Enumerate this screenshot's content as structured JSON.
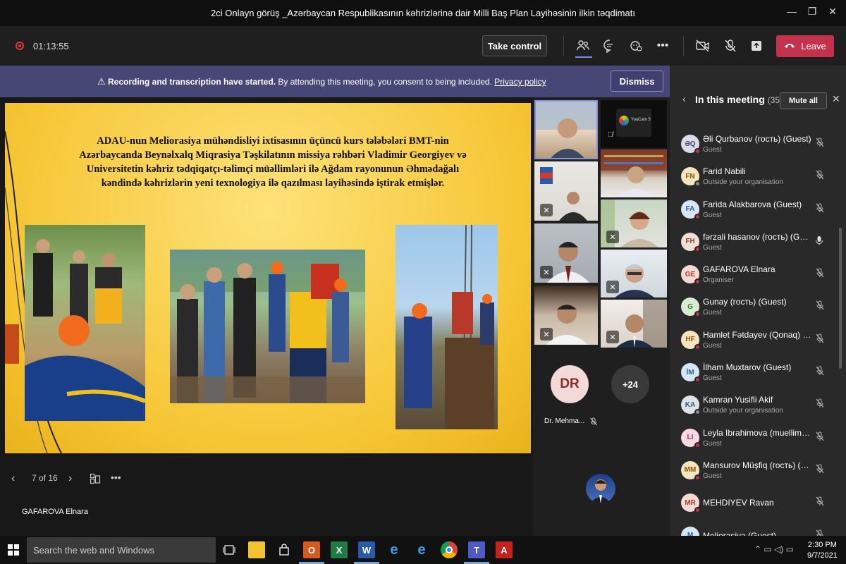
{
  "window": {
    "title": "2ci Onlayn görüş _Azərbaycan Respublikasının kəhrizlərinə dair Milli Baş Plan Layihəsinin ilkin təqdimatı",
    "minimize": "—",
    "maximize": "❐",
    "close": "✕"
  },
  "toolbar": {
    "timer": "01:13:55",
    "take_control": "Take control",
    "leave": "Leave"
  },
  "banner": {
    "bold": "Recording and transcription have started.",
    "text": " By attending this meeting, you consent to being included. ",
    "link": "Privacy policy",
    "dismiss": "Dismiss"
  },
  "slide": {
    "headline_lines": [
      "ADAU-nun Meliorasiya mühəndisliyi ixtisasının üçüncü kurs tələbələri BMT-nin",
      "Azərbaycanda Beynəlxalq Miqrasiya Təşkilatının missiya rəhbəri Vladimir Georgiyev və",
      "Universitetin kəhriz  tədqiqatçı-təlimçi  müəllimləri ilə Ağdam rayonunun Əhmədağalı",
      "kəndində  kəhrizlərin yeni texnologiya ilə qazılması layihəsində iştirak etmişlər."
    ],
    "page": "7 of 16",
    "presenter": "GAFAROVA Elnara"
  },
  "gallery": {
    "overflow_count": "+24",
    "dr_initials": "DR",
    "dr_name": "Dr. Mehma...",
    "youcam_label": "YouCam 5"
  },
  "panel": {
    "title": "In this meeting",
    "count": "(35)",
    "mute_all": "Mute all",
    "participants": [
      {
        "initials": "ƏQ",
        "name": "Əli Qurbanov (гость) (Guest)",
        "role": "Guest",
        "bg": "#d9dbe8",
        "fg": "#44476e",
        "dot": "#c4314b",
        "mic": "muted"
      },
      {
        "initials": "FN",
        "name": "Farid Nabili",
        "role": "Outside your organisation",
        "bg": "#f6e5c1",
        "fg": "#8a5a00",
        "dot": "#8a8a8a",
        "mic": "muted"
      },
      {
        "initials": "FA",
        "name": "Farida Alakbarova (Guest)",
        "role": "Guest",
        "bg": "#d6e6f5",
        "fg": "#2f5f8f",
        "dot": "#c4314b",
        "mic": "muted"
      },
      {
        "initials": "FH",
        "name": "fərzali hasanov (гость) (Guest)",
        "role": "Guest",
        "bg": "#efe0d6",
        "fg": "#8a4a2a",
        "dot": "#c4314b",
        "mic": "on"
      },
      {
        "initials": "GE",
        "name": "GAFAROVA Elnara",
        "role": "Organiser",
        "bg": "#f7d9d3",
        "fg": "#a33d2e",
        "dot": "#c4314b",
        "mic": "muted"
      },
      {
        "initials": "G",
        "name": "Gunay (гость) (Guest)",
        "role": "Guest",
        "bg": "#d9ecd3",
        "fg": "#3f7a2e",
        "dot": "#c4314b",
        "mic": "muted"
      },
      {
        "initials": "HF",
        "name": "Hamlet Fətdayev (Qonaq) (Gu...",
        "role": "Guest",
        "bg": "#f6e5c1",
        "fg": "#8a5a00",
        "dot": "#c4314b",
        "mic": "muted"
      },
      {
        "initials": "İM",
        "name": "İlham Muxtarov (Guest)",
        "role": "Guest",
        "bg": "#d6e6f5",
        "fg": "#2f5f8f",
        "dot": "#c4314b",
        "mic": "muted"
      },
      {
        "initials": "KA",
        "name": "Kamran Yusifli Akif",
        "role": "Outside your organisation",
        "bg": "#dde3ea",
        "fg": "#3e4f63",
        "dot": "#8a8a8a",
        "mic": "muted"
      },
      {
        "initials": "LI",
        "name": "Leyla Ibrahimova (muellim) (G...",
        "role": "Guest",
        "bg": "#f7d9e4",
        "fg": "#a3305a",
        "dot": "#c4314b",
        "mic": "muted"
      },
      {
        "initials": "MM",
        "name": "Mansurov Müşfiq (гость) (Gu...",
        "role": "Guest",
        "bg": "#f6e5c1",
        "fg": "#8a5a00",
        "dot": "#c4314b",
        "mic": "muted"
      },
      {
        "initials": "MR",
        "name": "MEHDIYEV Ravan",
        "role": "",
        "bg": "#f7d9d3",
        "fg": "#a33d2e",
        "dot": "#c4314b",
        "mic": "muted"
      },
      {
        "initials": "M",
        "name": "Meliorasiya (Guest)",
        "role": "",
        "bg": "#d6e6f5",
        "fg": "#2f5f8f",
        "dot": "#c4314b",
        "mic": "muted"
      }
    ]
  },
  "taskbar": {
    "search_placeholder": "Search the web and Windows",
    "time": "2:30 PM",
    "date": "9/7/2021"
  },
  "colors": {
    "accent": "#464775",
    "leave": "#c4314b",
    "slide_bg": "#f6c533"
  }
}
